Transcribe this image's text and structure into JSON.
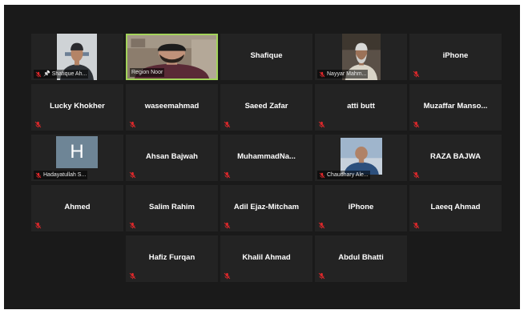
{
  "colors": {
    "background": "#1a1a1a",
    "tile": "#232323",
    "active_speaker_border": "#a3d35a",
    "muted_mic": "#e0282b"
  },
  "participants": [
    {
      "name": "Shafique Ah...",
      "type": "video",
      "pinned": true,
      "muted": true
    },
    {
      "name": "Region Noor",
      "type": "video",
      "active_speaker": true,
      "muted": false
    },
    {
      "name": "Shafique",
      "type": "name",
      "muted": false
    },
    {
      "name": "Nayyar Mahm...",
      "type": "video",
      "muted": true
    },
    {
      "name": "iPhone",
      "type": "name",
      "muted": true
    },
    {
      "name": "Lucky Khokher",
      "type": "name",
      "muted": true
    },
    {
      "name": "waseemahmad",
      "type": "name",
      "muted": true
    },
    {
      "name": "Saeed Zafar",
      "type": "name",
      "muted": true
    },
    {
      "name": "atti butt",
      "type": "name",
      "muted": true
    },
    {
      "name": "Muzaffar Manso...",
      "type": "name",
      "muted": true
    },
    {
      "name": "Hadayatullah S...",
      "type": "avatar",
      "avatar_letter": "H",
      "muted": true
    },
    {
      "name": "Ahsan Bajwah",
      "type": "name",
      "muted": true
    },
    {
      "name": "MuhammadNa...",
      "type": "name",
      "muted": true
    },
    {
      "name": "Chaudhary Ale...",
      "type": "photo",
      "muted": true
    },
    {
      "name": "RAZA BAJWA",
      "type": "name",
      "muted": true
    },
    {
      "name": "Ahmed",
      "type": "name",
      "muted": true
    },
    {
      "name": "Salim Rahim",
      "type": "name",
      "muted": true
    },
    {
      "name": "Adil Ejaz-Mitcham",
      "type": "name",
      "muted": true
    },
    {
      "name": "iPhone",
      "type": "name",
      "muted": true
    },
    {
      "name": "Laeeq Ahmad",
      "type": "name",
      "muted": true
    },
    {
      "name": "Hafiz Furqan",
      "type": "name",
      "muted": true
    },
    {
      "name": "Khalil Ahmad",
      "type": "name",
      "muted": true
    },
    {
      "name": "Abdul Bhatti",
      "type": "name",
      "muted": true
    }
  ]
}
